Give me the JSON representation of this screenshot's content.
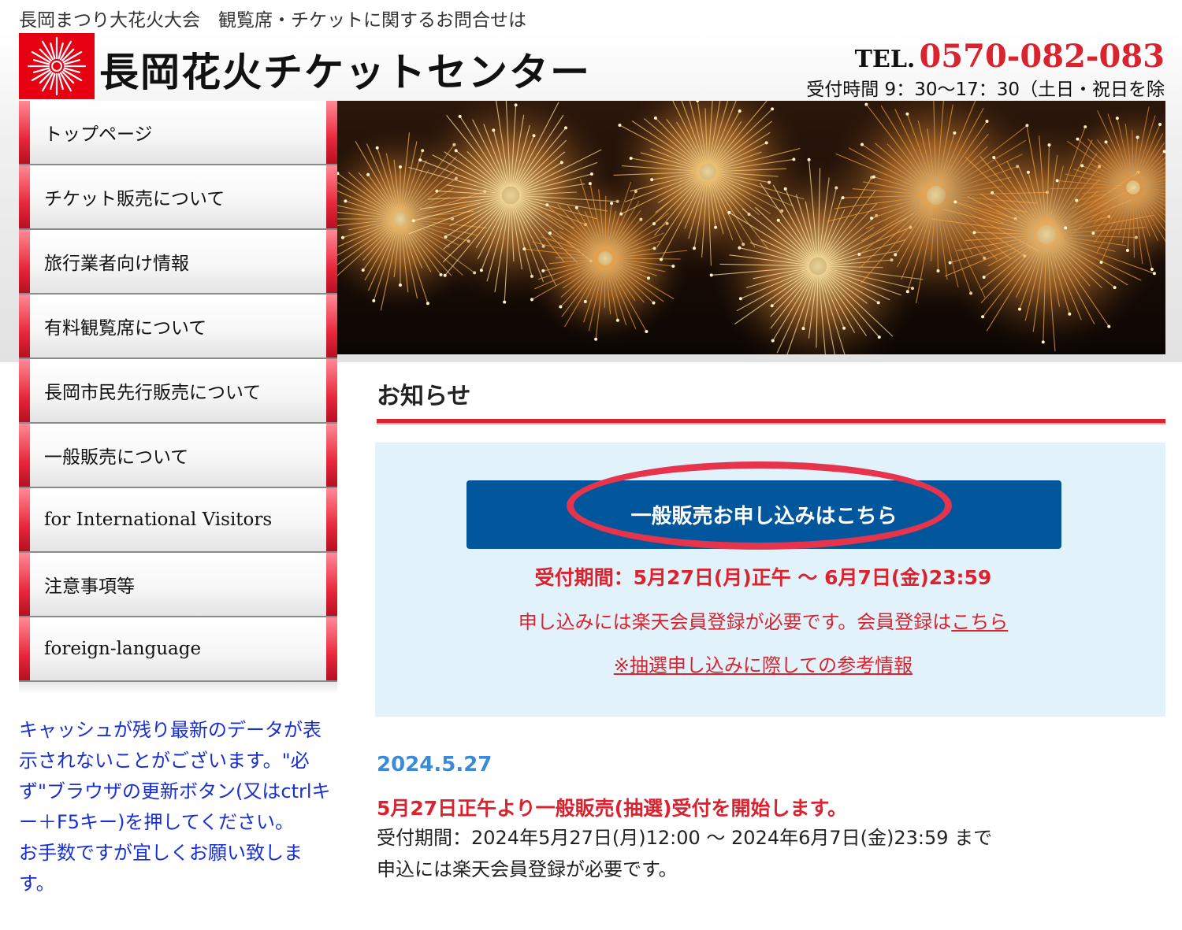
{
  "header": {
    "top_notice": "長岡まつり大花火大会　観覧席・チケットに関するお問合せは",
    "site_title": "長岡花火チケットセンター",
    "tel_label": "TEL.",
    "tel_number": "0570-082-083",
    "hours": "受付時間 9：30〜17：30（土日・祝日を除"
  },
  "sidebar": {
    "items": [
      {
        "label": "トップページ"
      },
      {
        "label": "チケット販売について"
      },
      {
        "label": "旅行業者向け情報"
      },
      {
        "label": "有料観覧席について"
      },
      {
        "label": "長岡市民先行販売について"
      },
      {
        "label": "一般販売について"
      },
      {
        "label": "for International Visitors"
      },
      {
        "label": "注意事項等"
      },
      {
        "label": "foreign-language"
      }
    ],
    "cache_note": "キャッシュが残り最新のデータが表示されないことがございます。\"必ず\"ブラウザの更新ボタン(又はctrlキー＋F5キー)を押してください。\nお手数ですが宜しくお願い致します。"
  },
  "main": {
    "section_title": "お知らせ",
    "notice": {
      "button_label": "一般販売お申し込みはこちら",
      "period": "受付期間：5月27日(月)正午 〜 6月7日(金)23:59",
      "member_text": "申し込みには楽天会員登録が必要です。会員登録は",
      "member_link": "こちら",
      "reference_link": "※抽選申し込みに際しての参考情報"
    },
    "news": {
      "date": "2024.5.27",
      "headline": "5月27日正午より一般販売(抽選)受付を開始します。",
      "body_line1": "受付期間：2024年5月27日(月)12:00 〜 2024年6月7日(金)23:59 まで",
      "body_line2": "申込には楽天会員登録が必要です。"
    }
  },
  "colors": {
    "accent_red": "#d9232f",
    "button_blue": "#02569c",
    "notice_bg": "#e1f2fb",
    "note_blue": "#1a2fd0",
    "date_blue": "#3b8ad6"
  },
  "icons": {
    "logo": "firework-burst-icon"
  }
}
